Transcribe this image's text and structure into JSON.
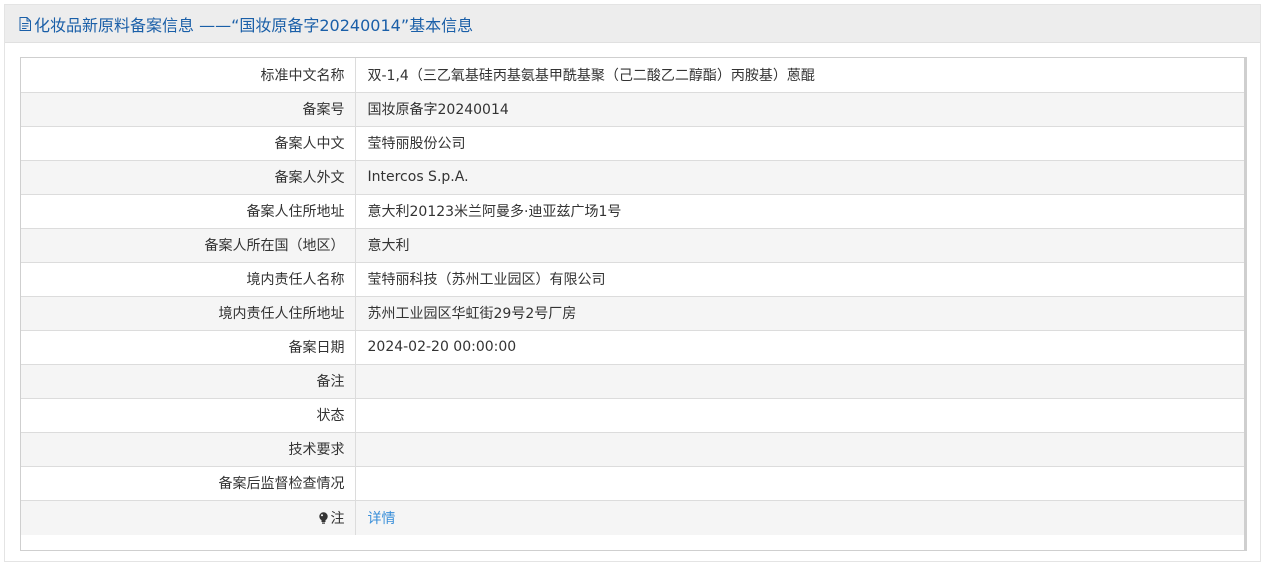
{
  "header": {
    "icon": "document-icon",
    "title": "化妆品新原料备案信息 ——“国妆原备字20240014”基本信息"
  },
  "rows": [
    {
      "label": "标准中文名称",
      "value": "双-1,4（三乙氧基硅丙基氨基甲酰基聚（己二酸乙二醇酯）丙胺基）蒽醌"
    },
    {
      "label": "备案号",
      "value": "国妆原备字20240014"
    },
    {
      "label": "备案人中文",
      "value": "莹特丽股份公司"
    },
    {
      "label": "备案人外文",
      "value": "Intercos S.p.A."
    },
    {
      "label": "备案人住所地址",
      "value": "意大利20123米兰阿曼多·迪亚兹广场1号"
    },
    {
      "label": "备案人所在国（地区）",
      "value": "意大利"
    },
    {
      "label": "境内责任人名称",
      "value": "莹特丽科技（苏州工业园区）有限公司"
    },
    {
      "label": "境内责任人住所地址",
      "value": "苏州工业园区华虹街29号2号厂房"
    },
    {
      "label": "备案日期",
      "value": "2024-02-20 00:00:00"
    },
    {
      "label": "备注",
      "value": ""
    },
    {
      "label": "状态",
      "value": ""
    },
    {
      "label": "技术要求",
      "value": ""
    },
    {
      "label": "备案后监督检查情况",
      "value": ""
    }
  ],
  "note": {
    "icon": "lightbulb-icon",
    "label": "注",
    "link_text": "详情"
  },
  "colors": {
    "title": "#1a5fa8",
    "link": "#3a8fd9",
    "header_bg": "#ededed",
    "row_alt_bg": "#f5f5f5"
  }
}
